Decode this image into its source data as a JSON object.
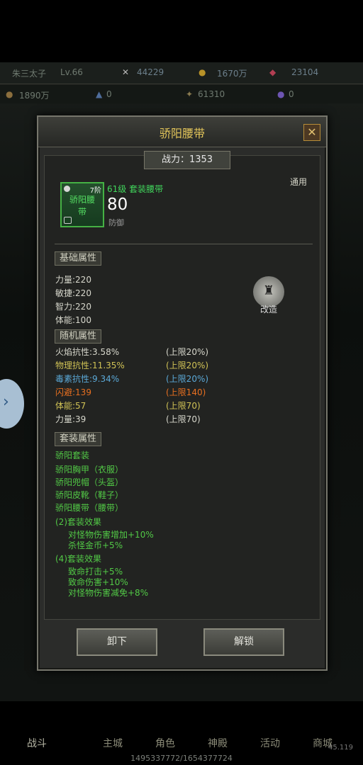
{
  "top": {
    "player": "朱三太子",
    "level": "Lv.66",
    "attack": "44229",
    "gold": "1670万",
    "gems": "23104"
  },
  "resources": [
    "1890万",
    "0",
    "61310",
    "0"
  ],
  "bottom_nav": [
    "战斗",
    "主城",
    "角色",
    "神殿",
    "活动",
    "商城"
  ],
  "bottom_right_text": "45.119",
  "exp": "1495337772/1654377724",
  "item": {
    "title": "骄阳腰带",
    "power": "战力：1353",
    "usage": "通用",
    "grade": "7阶",
    "name_short": "骄阳腰带",
    "level_type": "61级  套装腰带",
    "defense_value": "80",
    "defense_label": "防御"
  },
  "base_attributes": {
    "heading": "基础属性",
    "items": [
      "力量:220",
      "敏捷:220",
      "智力:220",
      "体能:100"
    ]
  },
  "reform_label": "改造",
  "random_attributes": {
    "heading": "随机属性",
    "items": [
      {
        "text": "火焰抗性:3.58%",
        "cap": "(上限20%)",
        "color": "#d7d7cc"
      },
      {
        "text": "物理抗性:11.35%",
        "cap": "(上限20%)",
        "color": "#d0c255"
      },
      {
        "text": "毒素抗性:9.34%",
        "cap": "(上限20%)",
        "color": "#5ba9d8"
      },
      {
        "text": "闪避:139",
        "cap": "(上限140)",
        "color": "#e76f20"
      },
      {
        "text": "体能:57",
        "cap": "(上限70)",
        "color": "#d0c255"
      },
      {
        "text": "力量:39",
        "cap": "(上限70)",
        "color": "#d7d7cc"
      }
    ]
  },
  "set_attributes": {
    "heading": "套装属性",
    "set_name": "骄阳套装",
    "pieces": [
      "骄阳胸甲（衣服）",
      "骄阳兜帽（头盔）",
      "骄阳皮靴（鞋子）",
      "骄阳腰带（腰带）"
    ],
    "effect2_title": "(2)套装效果",
    "effect2": [
      "对怪物伤害增加+10%",
      "杀怪金币+5%"
    ],
    "effect4_title": "(4)套装效果",
    "effect4": [
      "致命打击+5%",
      "致命伤害+10%",
      "对怪物伤害减免+8%"
    ]
  },
  "buttons": {
    "unequip": "卸下",
    "unlock": "解锁"
  }
}
